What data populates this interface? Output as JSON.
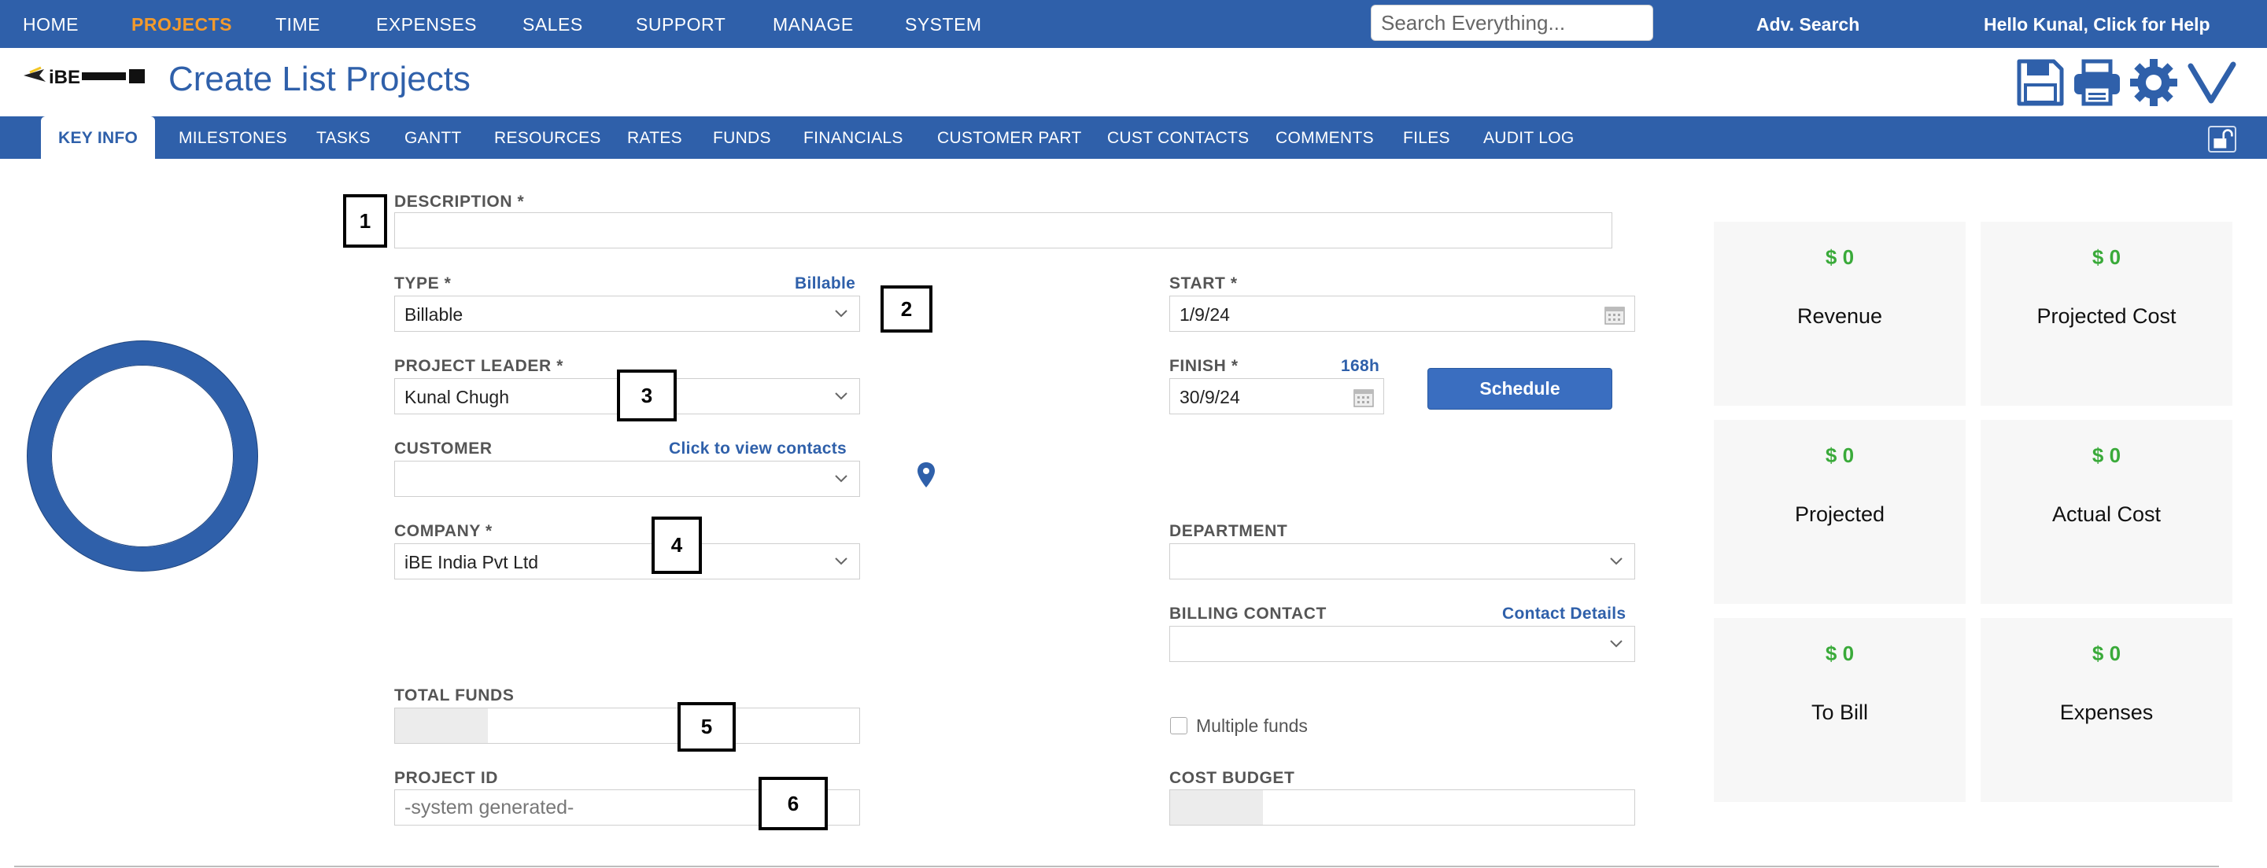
{
  "topnav": {
    "items": [
      {
        "label": "HOME"
      },
      {
        "label": "PROJECTS",
        "active": true
      },
      {
        "label": "TIME"
      },
      {
        "label": "EXPENSES"
      },
      {
        "label": "SALES"
      },
      {
        "label": "SUPPORT"
      },
      {
        "label": "MANAGE"
      },
      {
        "label": "SYSTEM"
      }
    ],
    "search_placeholder": "Search Everything...",
    "adv_search": "Adv. Search",
    "greeting": "Hello Kunal, Click for Help"
  },
  "header": {
    "title": "Create List Projects",
    "logo_text": "iBE",
    "icons": [
      "save-icon",
      "print-icon",
      "settings-icon",
      "check-icon"
    ]
  },
  "tabs": [
    {
      "label": "KEY INFO",
      "active": true
    },
    {
      "label": "MILESTONES"
    },
    {
      "label": "TASKS"
    },
    {
      "label": "GANTT"
    },
    {
      "label": "RESOURCES"
    },
    {
      "label": "RATES"
    },
    {
      "label": "FUNDS"
    },
    {
      "label": "FINANCIALS"
    },
    {
      "label": "CUSTOMER PART"
    },
    {
      "label": "CUST CONTACTS"
    },
    {
      "label": "COMMENTS"
    },
    {
      "label": "FILES"
    },
    {
      "label": "AUDIT LOG"
    }
  ],
  "form": {
    "description": {
      "label": "DESCRIPTION *",
      "value": ""
    },
    "type": {
      "label": "TYPE *",
      "link": "Billable",
      "value": "Billable"
    },
    "start": {
      "label": "START *",
      "value": "1/9/24"
    },
    "project_leader": {
      "label": "PROJECT LEADER *",
      "value": "Kunal Chugh"
    },
    "finish": {
      "label": "FINISH *",
      "hours": "168h",
      "value": "30/9/24"
    },
    "schedule_button": "Schedule",
    "customer": {
      "label": "CUSTOMER",
      "link": "Click to view contacts",
      "value": ""
    },
    "company": {
      "label": "COMPANY *",
      "value": "iBE India Pvt Ltd"
    },
    "department": {
      "label": "DEPARTMENT",
      "value": ""
    },
    "billing_contact": {
      "label": "BILLING CONTACT",
      "link": "Contact Details",
      "value": ""
    },
    "total_funds": {
      "label": "TOTAL FUNDS",
      "value": ""
    },
    "multiple_funds": {
      "label": "Multiple funds",
      "checked": false
    },
    "project_id": {
      "label": "PROJECT ID",
      "placeholder": "-system generated-"
    },
    "cost_budget": {
      "label": "COST BUDGET",
      "value": ""
    }
  },
  "annotations": [
    "1",
    "2",
    "3",
    "4",
    "5",
    "6"
  ],
  "summary": [
    {
      "value": "$ 0",
      "caption": "Revenue"
    },
    {
      "value": "$ 0",
      "caption": "Projected Cost"
    },
    {
      "value": "$ 0",
      "caption": "Projected"
    },
    {
      "value": "$ 0",
      "caption": "Actual Cost"
    },
    {
      "value": "$ 0",
      "caption": "To Bill"
    },
    {
      "value": "$ 0",
      "caption": "Expenses"
    }
  ],
  "colors": {
    "brand": "#2f60aa",
    "active_nav": "#f39a2c",
    "money": "#3aaa3a"
  }
}
